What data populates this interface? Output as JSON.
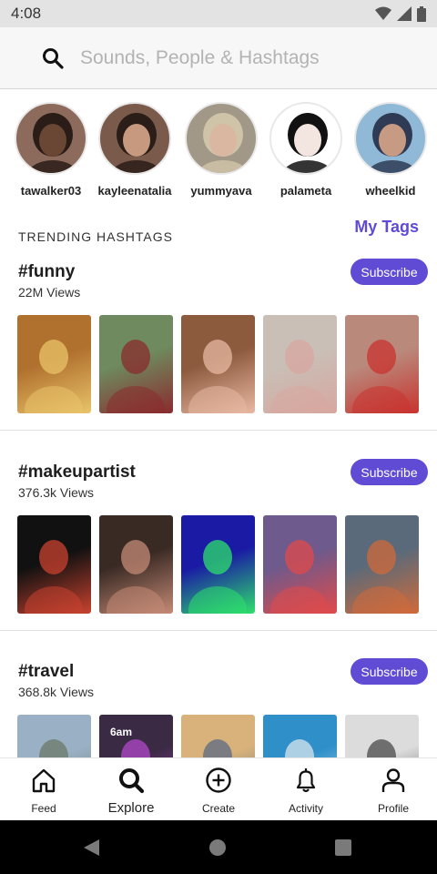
{
  "status_bar": {
    "time": "4:08"
  },
  "search": {
    "placeholder": "Sounds, People & Hashtags"
  },
  "people": [
    {
      "username": "tawalker03",
      "bg": "#8d6b5c",
      "face": "#6a4634",
      "hair": "#2a1c16"
    },
    {
      "username": "kayleenatalia",
      "bg": "#7a5a4b",
      "face": "#c79a80",
      "hair": "#2b1d17"
    },
    {
      "username": "yummyava",
      "bg": "#a29888",
      "face": "#d9b7a0",
      "hair": "#cfc3a8"
    },
    {
      "username": "palameta",
      "bg": "#ffffff",
      "face": "#f3e6e0",
      "hair": "#111111"
    },
    {
      "username": "wheelkid",
      "bg": "#8fb9d6",
      "face": "#c79b83",
      "hair": "#2f3b55"
    }
  ],
  "trending": {
    "title": "TRENDING HASHTAGS",
    "my_tags": "My Tags"
  },
  "hashtags": [
    {
      "tag": "#funny",
      "views": "22M Views",
      "subscribe": "Subscribe",
      "thumbs": [
        {
          "bg": "#b0702e",
          "fg": "#e9c36a"
        },
        {
          "bg": "#6e8a5e",
          "fg": "#8a2b2e"
        },
        {
          "bg": "#8c5a3d",
          "fg": "#e8b8a2"
        },
        {
          "bg": "#c9bfb6",
          "fg": "#d7a7a0"
        },
        {
          "bg": "#b98a7c",
          "fg": "#c9332f"
        }
      ]
    },
    {
      "tag": "#makeupartist",
      "views": "376.3k Views",
      "subscribe": "Subscribe",
      "thumbs": [
        {
          "bg": "#111111",
          "fg": "#c9422f"
        },
        {
          "bg": "#3a2a24",
          "fg": "#c48a76"
        },
        {
          "bg": "#1a1aa5",
          "fg": "#2ee06b"
        },
        {
          "bg": "#6e5a8c",
          "fg": "#e04a4a"
        },
        {
          "bg": "#5a6a7a",
          "fg": "#d06a3a"
        }
      ]
    },
    {
      "tag": "#travel",
      "views": "368.8k Views",
      "subscribe": "Subscribe",
      "thumbs": [
        {
          "bg": "#9ab0c4",
          "fg": "#6b7a6a",
          "label": ""
        },
        {
          "bg": "#3a2a44",
          "fg": "#b24ac9",
          "label": "6am"
        },
        {
          "bg": "#d8b27a",
          "fg": "#5b6a86",
          "label": ""
        },
        {
          "bg": "#2f8fc9",
          "fg": "#d8e6ee",
          "label": ""
        },
        {
          "bg": "#dcdcdc",
          "fg": "#4a4a4a",
          "label": ""
        }
      ]
    }
  ],
  "nav": [
    {
      "label": "Feed",
      "icon": "home-icon"
    },
    {
      "label": "Explore",
      "icon": "search-icon",
      "active": true
    },
    {
      "label": "Create",
      "icon": "plus-circle-icon"
    },
    {
      "label": "Activity",
      "icon": "bell-icon"
    },
    {
      "label": "Profile",
      "icon": "user-icon"
    }
  ],
  "colors": {
    "accent": "#5f4bd4",
    "status_bar": "#e3e3e3",
    "system_nav": "#000000"
  }
}
